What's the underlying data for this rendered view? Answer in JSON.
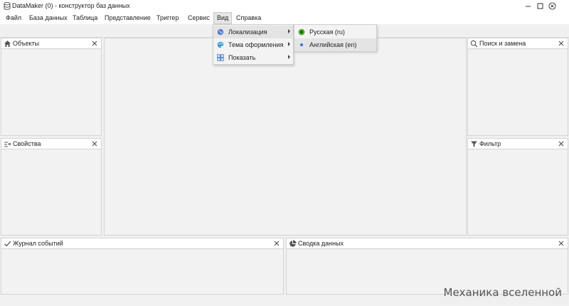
{
  "window": {
    "title": "DataMaker (0) - конструктор баз данных"
  },
  "menu": {
    "items": [
      "Файл",
      "База данных",
      "Таблица",
      "Представление",
      "Триггер",
      "Сервис",
      "Вид",
      "Справка"
    ],
    "open_item": "Вид"
  },
  "view_menu": {
    "items": [
      {
        "label": "Локализация",
        "icon": "globe-icon",
        "submenu": true
      },
      {
        "label": "Тема оформления",
        "icon": "palette-icon",
        "submenu": true
      },
      {
        "label": "Показать",
        "icon": "grid-icon",
        "submenu": true
      }
    ]
  },
  "localization_menu": {
    "items": [
      {
        "label": "Русская (ru)",
        "selected": true
      },
      {
        "label": "Английская (en)",
        "selected": false
      }
    ]
  },
  "panels": {
    "objects": {
      "title": "Объекты",
      "icon": "home-icon"
    },
    "properties": {
      "title": "Свойства",
      "icon": "properties-icon"
    },
    "search": {
      "title": "Поиск и замена",
      "icon": "search-icon"
    },
    "filter": {
      "title": "Фильтр",
      "icon": "filter-icon"
    },
    "event_log": {
      "title": "Журнал событий",
      "icon": "checkmark-icon"
    },
    "data_summary": {
      "title": "Сводка данных",
      "icon": "pie-chart-icon"
    }
  },
  "watermark": "Механика вселенной",
  "colors": {
    "accent_green": "#4caf2a",
    "accent_blue": "#3c6fd0",
    "icon_gray": "#555555"
  }
}
